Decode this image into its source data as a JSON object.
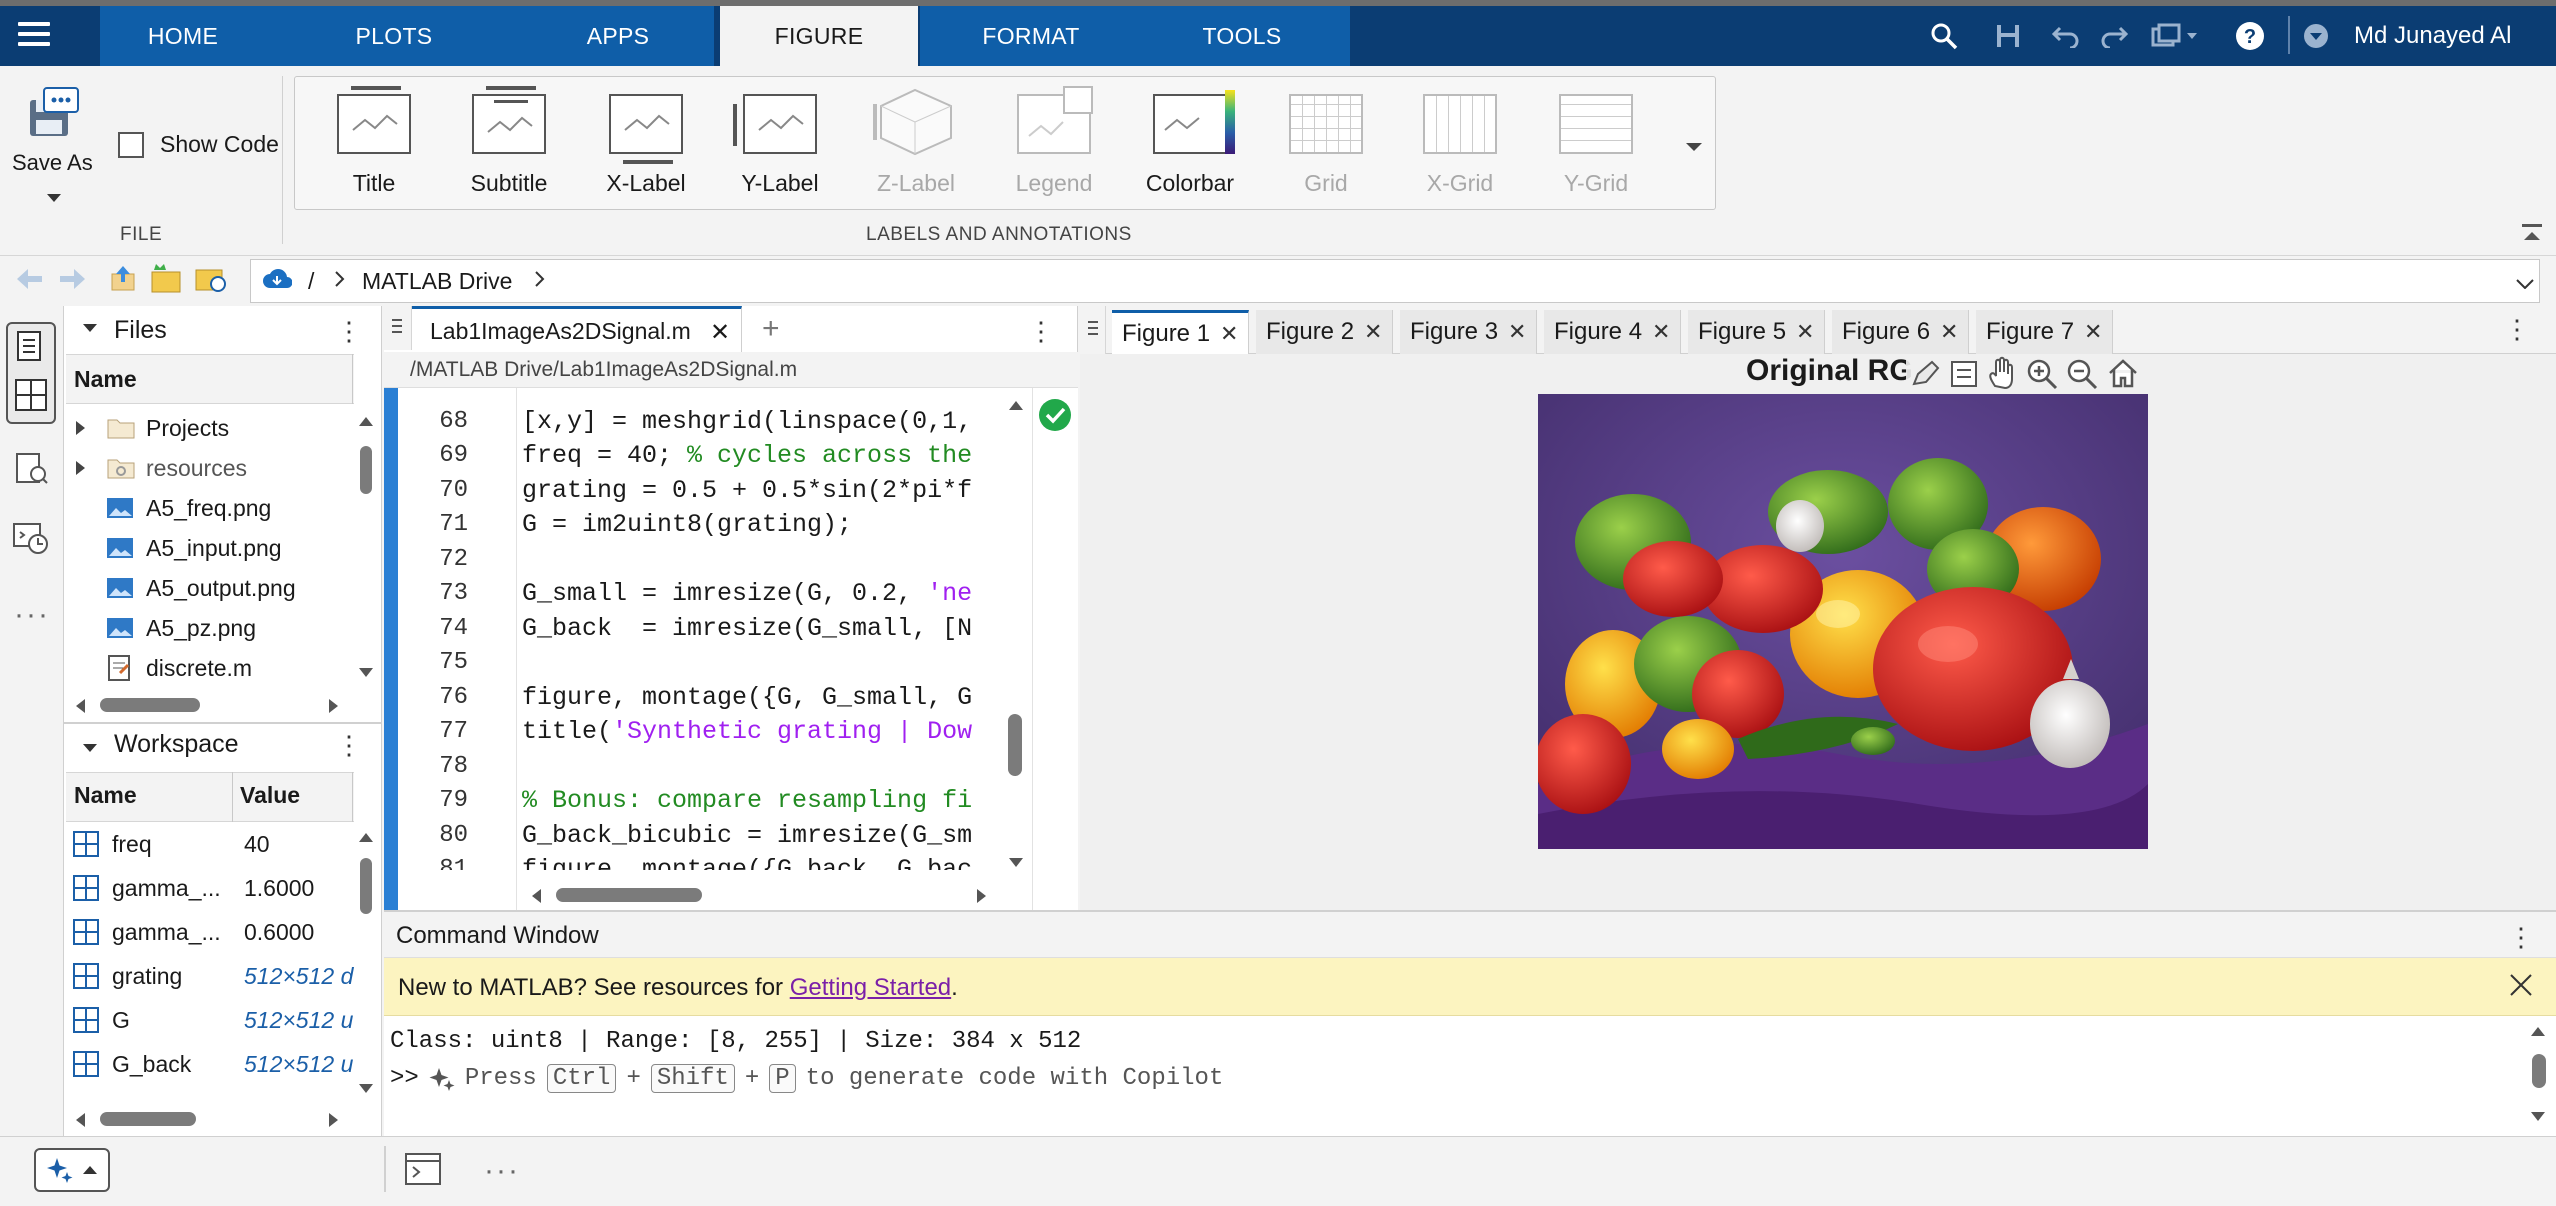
{
  "toolstrip": {
    "tabs": [
      "HOME",
      "PLOTS",
      "APPS",
      "FIGURE",
      "FORMAT",
      "TOOLS"
    ],
    "active_tab": "FIGURE",
    "user": "Md Junayed Al"
  },
  "ribbon": {
    "save_as": "Save As",
    "show_code": "Show Code",
    "file_section": "FILE",
    "labels_section": "LABELS AND ANNOTATIONS",
    "buttons": [
      "Title",
      "Subtitle",
      "X-Label",
      "Y-Label",
      "Z-Label",
      "Legend",
      "Colorbar",
      "Grid",
      "X-Grid",
      "Y-Grid"
    ]
  },
  "address": {
    "sep": "/",
    "location": "MATLAB Drive"
  },
  "files": {
    "title": "Files",
    "col_name": "Name",
    "items": [
      {
        "name": "Projects",
        "kind": "folder"
      },
      {
        "name": "resources",
        "kind": "folder"
      },
      {
        "name": "A5_freq.png",
        "kind": "image"
      },
      {
        "name": "A5_input.png",
        "kind": "image"
      },
      {
        "name": "A5_output.png",
        "kind": "image"
      },
      {
        "name": "A5_pz.png",
        "kind": "image"
      },
      {
        "name": "discrete.m",
        "kind": "script"
      }
    ]
  },
  "workspace": {
    "title": "Workspace",
    "col_name": "Name",
    "col_value": "Value",
    "vars": [
      {
        "name": "freq",
        "value": "40",
        "italic": false
      },
      {
        "name": "gamma_...",
        "value": "1.6000",
        "italic": false
      },
      {
        "name": "gamma_...",
        "value": "0.6000",
        "italic": false
      },
      {
        "name": "grating",
        "value": "512×512 d",
        "italic": true
      },
      {
        "name": "G",
        "value": "512×512 u",
        "italic": true
      },
      {
        "name": "G_back",
        "value": "512×512 u",
        "italic": true
      }
    ]
  },
  "editor": {
    "tab": "Lab1ImageAs2DSignal.m",
    "path": "/MATLAB Drive/Lab1ImageAs2DSignal.m",
    "lines": [
      {
        "n": "68",
        "parts": [
          {
            "t": "[x,y] = meshgrid(linspace(0,1,",
            "c": ""
          }
        ]
      },
      {
        "n": "69",
        "parts": [
          {
            "t": "freq = 40; ",
            "c": ""
          },
          {
            "t": "% cycles across the",
            "c": "kw-green"
          }
        ]
      },
      {
        "n": "70",
        "parts": [
          {
            "t": "grating = 0.5 + 0.5*sin(2*pi*f",
            "c": ""
          }
        ]
      },
      {
        "n": "71",
        "parts": [
          {
            "t": "G = im2uint8(grating);",
            "c": ""
          }
        ]
      },
      {
        "n": "72",
        "parts": []
      },
      {
        "n": "73",
        "parts": [
          {
            "t": "G_small = imresize(G, 0.2, ",
            "c": ""
          },
          {
            "t": "'ne",
            "c": "str"
          }
        ]
      },
      {
        "n": "74",
        "parts": [
          {
            "t": "G_back  = imresize(G_small, [N",
            "c": ""
          }
        ]
      },
      {
        "n": "75",
        "parts": []
      },
      {
        "n": "76",
        "parts": [
          {
            "t": "figure, montage({G, G_small, G",
            "c": ""
          }
        ]
      },
      {
        "n": "77",
        "parts": [
          {
            "t": "title(",
            "c": ""
          },
          {
            "t": "'Synthetic grating | Dow",
            "c": "str"
          }
        ]
      },
      {
        "n": "78",
        "parts": []
      },
      {
        "n": "79",
        "parts": [
          {
            "t": "% Bonus: compare resampling fi",
            "c": "kw-green"
          }
        ]
      },
      {
        "n": "80",
        "parts": [
          {
            "t": "G_back_bicubic = imresize(G_sm",
            "c": ""
          }
        ]
      },
      {
        "n": "81",
        "parts": [
          {
            "t": "figure, montage({G_back, G_bac",
            "c": ""
          }
        ]
      }
    ]
  },
  "figures": {
    "tabs": [
      "Figure 1",
      "Figure 2",
      "Figure 3",
      "Figure 4",
      "Figure 5",
      "Figure 6",
      "Figure 7"
    ],
    "active": "Figure 1",
    "axes_title": "Original RG"
  },
  "command": {
    "title": "Command Window",
    "banner_text": "New to MATLAB? See resources for ",
    "banner_link": "Getting Started",
    "banner_end": ".",
    "output": "Class: uint8 | Range: [8, 255] | Size: 384 x 512",
    "prompt": ">>",
    "hint_press": "Press",
    "key_ctrl": "Ctrl",
    "key_shift": "Shift",
    "key_p": "P",
    "plus": "+",
    "hint_rest": "to generate code with Copilot"
  }
}
